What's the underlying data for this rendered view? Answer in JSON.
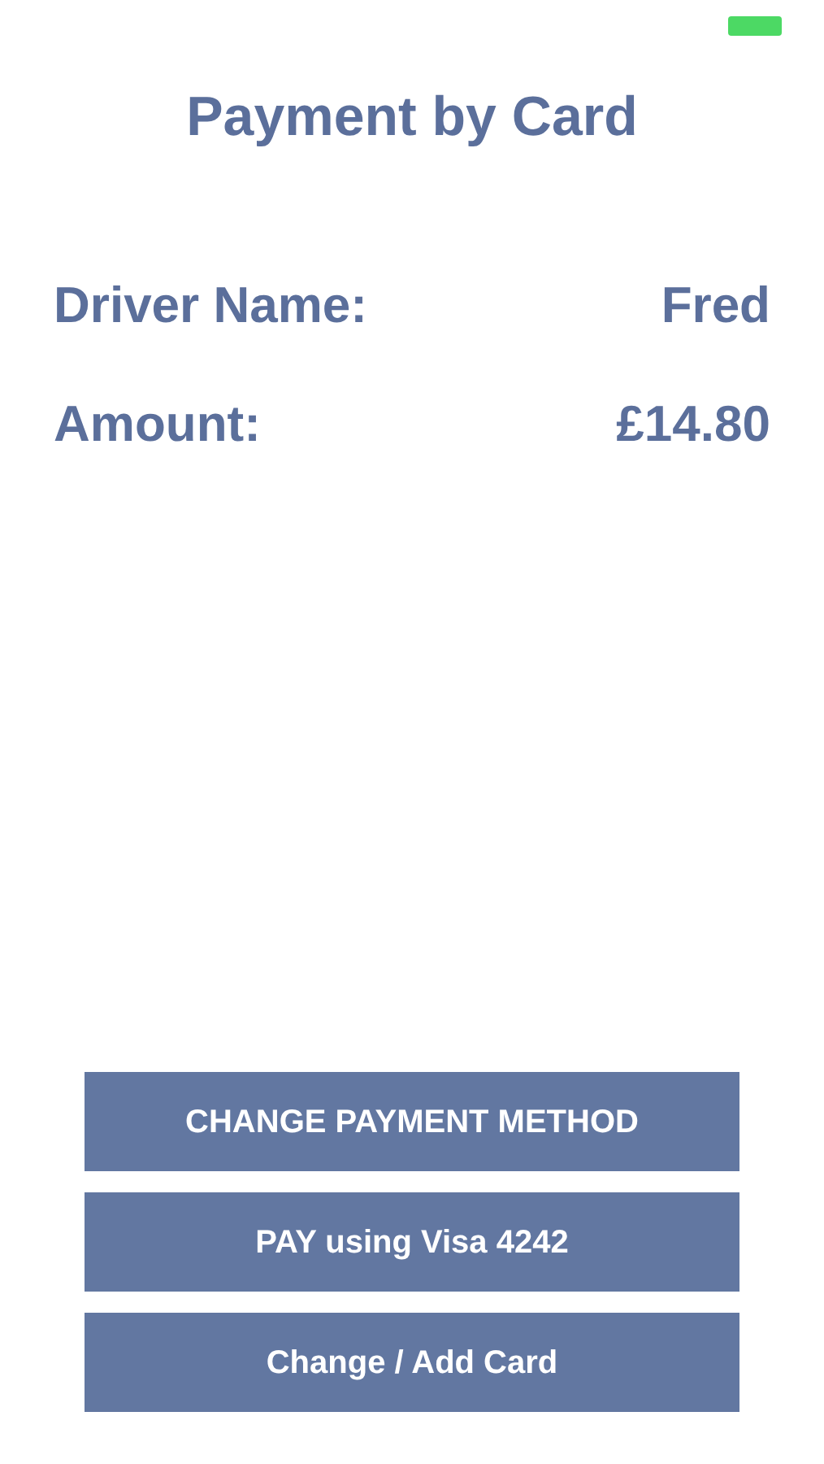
{
  "title": "Payment by Card",
  "details": [
    {
      "label": "Driver Name:",
      "value": "Fred"
    },
    {
      "label": "Amount:",
      "value": "£14.80"
    }
  ],
  "buttons": [
    "CHANGE PAYMENT METHOD",
    "PAY using Visa 4242",
    "Change / Add Card"
  ]
}
